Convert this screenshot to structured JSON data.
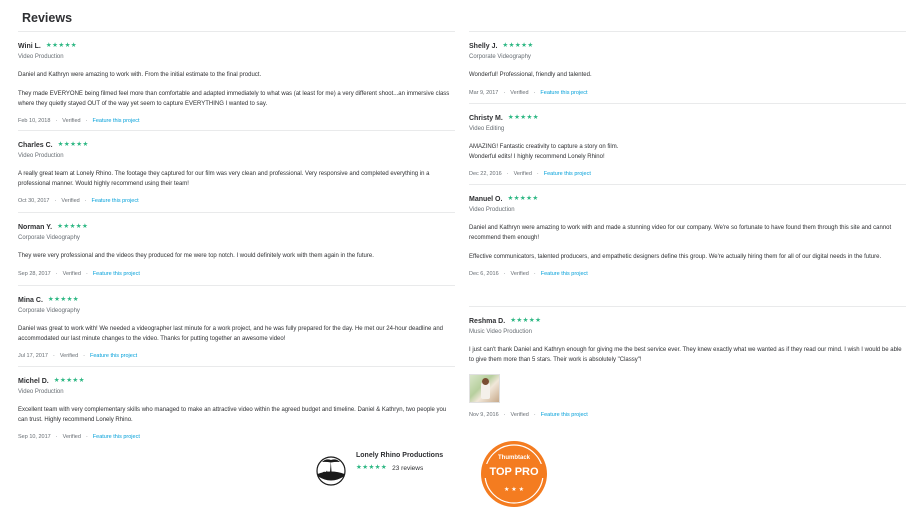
{
  "page": {
    "title": "Reviews"
  },
  "colors": {
    "star": "#2db783",
    "link": "#009fd9",
    "badge": "#f47c20"
  },
  "reviews_left": [
    {
      "name": "Wini L.",
      "stars": "★★★★★",
      "service": "Video Production",
      "paragraphs": [
        "Daniel and Kathryn were amazing to work with. From the initial estimate to the final product.",
        "They made EVERYONE being filmed feel more than comfortable and adapted immediately to what was (at least for me) a very different shoot...an immersive class where they quietly stayed OUT of the way yet seem to capture EVERYTHING I wanted to say."
      ],
      "date": "Feb 10, 2018",
      "verified": "Verified",
      "feature": "Feature this project"
    },
    {
      "name": "Charles C.",
      "stars": "★★★★★",
      "service": "Video Production",
      "paragraphs": [
        "A really great team at Lonely Rhino. The footage they captured for our film was very clean and professional. Very responsive and completed everything in a professional manner. Would highly recommend using their team!"
      ],
      "date": "Oct 30, 2017",
      "verified": "Verified",
      "feature": "Feature this project"
    },
    {
      "name": "Norman Y.",
      "stars": "★★★★★",
      "service": "Corporate Videography",
      "paragraphs": [
        "They were very professional and the videos they produced for me were top notch. I would definitely work with them again in the future."
      ],
      "date": "Sep 28, 2017",
      "verified": "Verified",
      "feature": "Feature this project"
    },
    {
      "name": "Mina C.",
      "stars": "★★★★★",
      "service": "Corporate Videography",
      "paragraphs": [
        "Daniel was great to work with! We needed a videographer last minute for a work project, and he was fully prepared for the day. He met our 24-hour deadline and accommodated our last minute changes to the video. Thanks for putting together an awesome video!"
      ],
      "date": "Jul 17, 2017",
      "verified": "Verified",
      "feature": "Feature this project"
    },
    {
      "name": "Michel D.",
      "stars": "★★★★★",
      "service": "Video Production",
      "paragraphs": [
        "Excellent team with very complementary skills who managed to make an attractive video within the agreed budget and timeline. Daniel & Kathryn, two people you can trust. Highly recommend Lonely Rhino."
      ],
      "date": "Sep 10, 2017",
      "verified": "Verified",
      "feature": "Feature this project"
    }
  ],
  "reviews_right": [
    {
      "name": "Shelly J.",
      "stars": "★★★★★",
      "service": "Corporate Videography",
      "paragraphs": [
        "Wonderful! Professional, friendly and talented."
      ],
      "date": "Mar 9, 2017",
      "verified": "Verified",
      "feature": "Feature this project"
    },
    {
      "name": "Christy M.",
      "stars": "★★★★★",
      "service": "Video Editing",
      "paragraphs": [
        "AMAZING! Fantastic creativity to capture a story on film.\nWonderful edits! I highly recommend Lonely Rhino!"
      ],
      "date": "Dec 22, 2016",
      "verified": "Verified",
      "feature": "Feature this project"
    },
    {
      "name": "Manuel O.",
      "stars": "★★★★★",
      "service": "Video Production",
      "paragraphs": [
        "Daniel and Kathryn were amazing to work with and made a stunning video for our company. We're so fortunate to have found them through this site and cannot recommend them enough!",
        "Effective communicators, talented producers, and empathetic designers define this group. We're actually hiring them for all of our digital needs in the future."
      ],
      "date": "Dec 6, 2016",
      "verified": "Verified",
      "feature": "Feature this project"
    },
    {
      "name": "Reshma D.",
      "stars": "★★★★★",
      "service": "Music Video Production",
      "paragraphs": [
        "I just can't thank Daniel and Kathryn enough for giving me the best service ever. They knew exactly what we wanted as if they read our mind. I wish I would be able to give them more than 5 stars. Their work is absolutely \"Classy\"!"
      ],
      "date": "Nov 9, 2016",
      "verified": "Verified",
      "feature": "Feature this project",
      "has_photo": true
    }
  ],
  "business": {
    "name": "Lonely Rhino Productions",
    "stars": "★★★★★",
    "review_count": "23 reviews"
  },
  "badge": {
    "brand": "Thumbtack",
    "label": "TOP PRO"
  }
}
